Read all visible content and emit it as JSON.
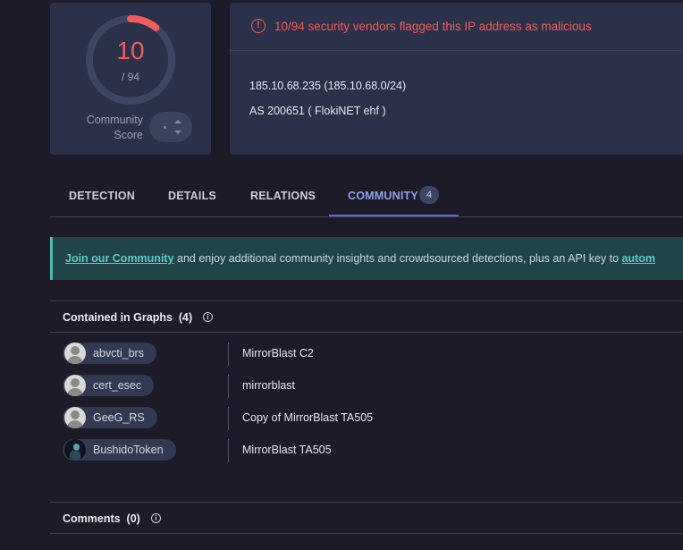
{
  "score": {
    "detections": "10",
    "total": "/ 94",
    "detection_fraction": 0.106,
    "community_label_1": "Community",
    "community_label_2": "Score"
  },
  "alert": {
    "icon": "alert-circle-icon",
    "text": "10/94 security vendors flagged this IP address as malicious"
  },
  "network": {
    "ip_line": "185.10.68.235  (185.10.68.0/24)",
    "as_line": "AS 200651  ( FlokiNET ehf )"
  },
  "tabs": [
    {
      "label": "DETECTION"
    },
    {
      "label": "DETAILS"
    },
    {
      "label": "RELATIONS"
    },
    {
      "label": "COMMUNITY",
      "badge": "4"
    }
  ],
  "banner": {
    "link": "Join our Community",
    "text": " and enjoy additional community insights and crowdsourced detections, plus an API key to ",
    "link2": "autom"
  },
  "graphs": {
    "title": "Contained in Graphs",
    "count": "(4)",
    "rows": [
      {
        "user": "abvcti_brs",
        "graph": "MirrorBlast C2"
      },
      {
        "user": "cert_esec",
        "graph": "mirrorblast"
      },
      {
        "user": "GeeG_RS",
        "graph": "Copy of MirrorBlast TA505"
      },
      {
        "user": "BushidoToken",
        "graph": "MirrorBlast TA505"
      }
    ]
  },
  "comments": {
    "title": "Comments",
    "count": "(0)"
  },
  "colors": {
    "accent_red": "#f15c5c",
    "tab_active": "#8ea1e6",
    "banner_link": "#5ec9c3"
  }
}
